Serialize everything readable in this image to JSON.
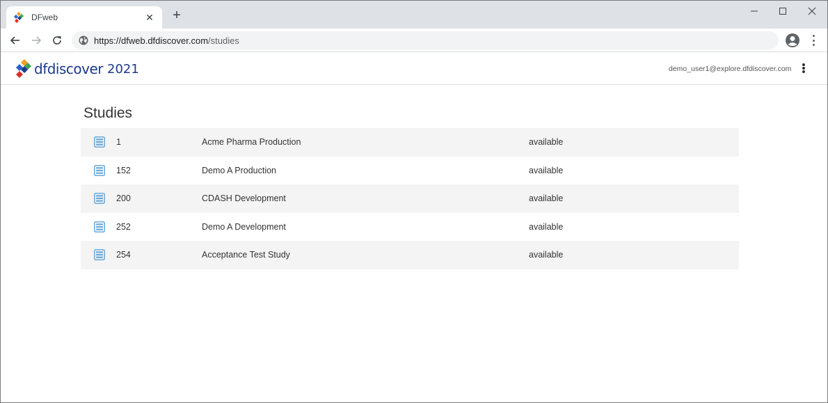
{
  "browser": {
    "tab_title": "DFweb",
    "tab_close": "✕",
    "new_tab": "+",
    "url_host": "https://dfweb.dfdiscover.com",
    "url_path": "/studies"
  },
  "header": {
    "brand": "dfdiscover",
    "year": "2021",
    "user": "demo_user1@explore.dfdiscover.com"
  },
  "main": {
    "title": "Studies",
    "studies": [
      {
        "number": "1",
        "name": "Acme Pharma Production",
        "status": "available"
      },
      {
        "number": "152",
        "name": "Demo A Production",
        "status": "available"
      },
      {
        "number": "200",
        "name": "CDASH Development",
        "status": "available"
      },
      {
        "number": "252",
        "name": "Demo A Development",
        "status": "available"
      },
      {
        "number": "254",
        "name": "Acceptance Test Study",
        "status": "available"
      }
    ]
  },
  "colors": {
    "brand": "#1d3a8a",
    "study_icon": "#6aa9d8",
    "stripe": "#f4f4f4"
  },
  "icons": {
    "study": "list-icon",
    "favicon": "dfdiscover-logo-icon"
  }
}
